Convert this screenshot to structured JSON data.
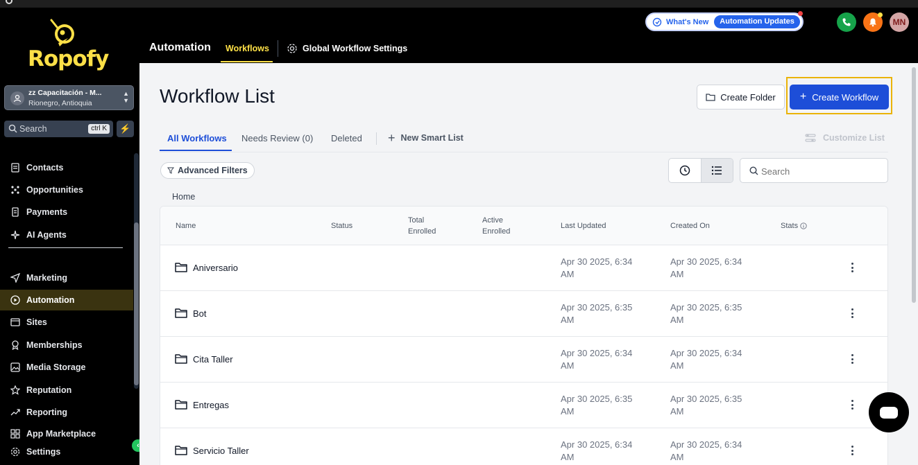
{
  "brand": {
    "name": "Ropofy"
  },
  "account": {
    "name": "zz Capacitación - M...",
    "location": "Rionegro, Antioquia"
  },
  "sidebar": {
    "search_label": "Search",
    "search_shortcut": "ctrl K",
    "items": [
      {
        "label": "Contacts",
        "icon": "contacts-icon"
      },
      {
        "label": "Opportunities",
        "icon": "opportunities-icon"
      },
      {
        "label": "Payments",
        "icon": "payments-icon"
      },
      {
        "label": "AI Agents",
        "icon": "ai-agents-icon"
      },
      {
        "label": "Marketing",
        "icon": "marketing-icon"
      },
      {
        "label": "Automation",
        "icon": "automation-icon",
        "active": true
      },
      {
        "label": "Sites",
        "icon": "sites-icon"
      },
      {
        "label": "Memberships",
        "icon": "memberships-icon"
      },
      {
        "label": "Media Storage",
        "icon": "media-storage-icon"
      },
      {
        "label": "Reputation",
        "icon": "reputation-icon"
      },
      {
        "label": "Reporting",
        "icon": "reporting-icon"
      },
      {
        "label": "App Marketplace",
        "icon": "app-marketplace-icon"
      },
      {
        "label": "Settings",
        "icon": "settings-icon"
      }
    ]
  },
  "header": {
    "section": "Automation",
    "tab_workflows": "Workflows",
    "tab_global_settings": "Global Workflow Settings",
    "whats_new": "What's New",
    "automation_updates": "Automation Updates",
    "user_initials": "MN"
  },
  "main": {
    "title": "Workflow List",
    "create_folder": "Create Folder",
    "create_workflow": "Create Workflow",
    "tabs": {
      "all": "All Workflows",
      "needs_review": "Needs Review (0)",
      "deleted": "Deleted",
      "new_smart_list": "New Smart List",
      "customize_list": "Customize List"
    },
    "advanced_filters": "Advanced Filters",
    "search_placeholder": "Search",
    "breadcrumb": "Home"
  },
  "table": {
    "headers": {
      "name": "Name",
      "status": "Status",
      "total_enrolled_1": "Total",
      "total_enrolled_2": "Enrolled",
      "active_enrolled_1": "Active",
      "active_enrolled_2": "Enrolled",
      "last_updated": "Last Updated",
      "created_on": "Created On",
      "stats": "Stats"
    },
    "rows": [
      {
        "name": "Aniversario",
        "updated_1": "Apr 30 2025, 6:34",
        "updated_2": "AM",
        "created_1": "Apr 30 2025, 6:34",
        "created_2": "AM"
      },
      {
        "name": "Bot",
        "updated_1": "Apr 30 2025, 6:35",
        "updated_2": "AM",
        "created_1": "Apr 30 2025, 6:35",
        "created_2": "AM"
      },
      {
        "name": "Cita Taller",
        "updated_1": "Apr 30 2025, 6:34",
        "updated_2": "AM",
        "created_1": "Apr 30 2025, 6:34",
        "created_2": "AM"
      },
      {
        "name": "Entregas",
        "updated_1": "Apr 30 2025, 6:35",
        "updated_2": "AM",
        "created_1": "Apr 30 2025, 6:35",
        "created_2": "AM"
      },
      {
        "name": "Servicio Taller",
        "updated_1": "Apr 30 2025, 6:34",
        "updated_2": "AM",
        "created_1": "Apr 30 2025, 6:34",
        "created_2": "AM"
      }
    ]
  },
  "colors": {
    "accent": "#1d4ed8",
    "brand_yellow": "#fde047",
    "highlight": "#eab308"
  }
}
